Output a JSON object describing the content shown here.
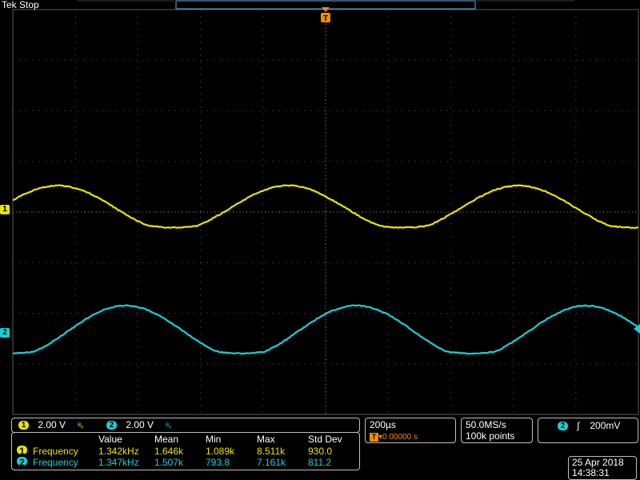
{
  "header": {
    "brand": "Tek",
    "state": "Stop"
  },
  "colors": {
    "ch1": "#e6e600",
    "ch2": "#19cfd6",
    "grid": "#5a5a5a",
    "trigger": "#f28c00"
  },
  "channels": [
    {
      "num": "1",
      "scale": "2.00 V",
      "suffix": "ᴮᵥ"
    },
    {
      "num": "2",
      "scale": "2.00 V",
      "suffix": "ᴮᵥ"
    }
  ],
  "timebase": {
    "scale": "200µs",
    "trig_position": "▾0.00000 s",
    "trig_icon": "T"
  },
  "acquisition": {
    "rate": "50.0MS/s",
    "record": "100k points"
  },
  "trigger": {
    "channel": "2",
    "slope": "ʃ",
    "level": "200mV"
  },
  "measurements": {
    "headers": [
      "Value",
      "Mean",
      "Min",
      "Max",
      "Std Dev"
    ],
    "rows": [
      {
        "ch": "1",
        "name": "Frequency",
        "value": "1.342kHz",
        "mean": "1.646k",
        "min": "1.089k",
        "max": "8.511k",
        "std": "930.0"
      },
      {
        "ch": "2",
        "name": "Frequency",
        "value": "1.347kHz",
        "mean": "1.507k",
        "min": "793.8",
        "max": "7.161k",
        "std": "811.2"
      }
    ]
  },
  "datetime": {
    "date": "25 Apr  2018",
    "time": "14:38:31"
  },
  "marker_labels": {
    "ch1": "1",
    "ch2": "2",
    "trigger": "T"
  }
}
